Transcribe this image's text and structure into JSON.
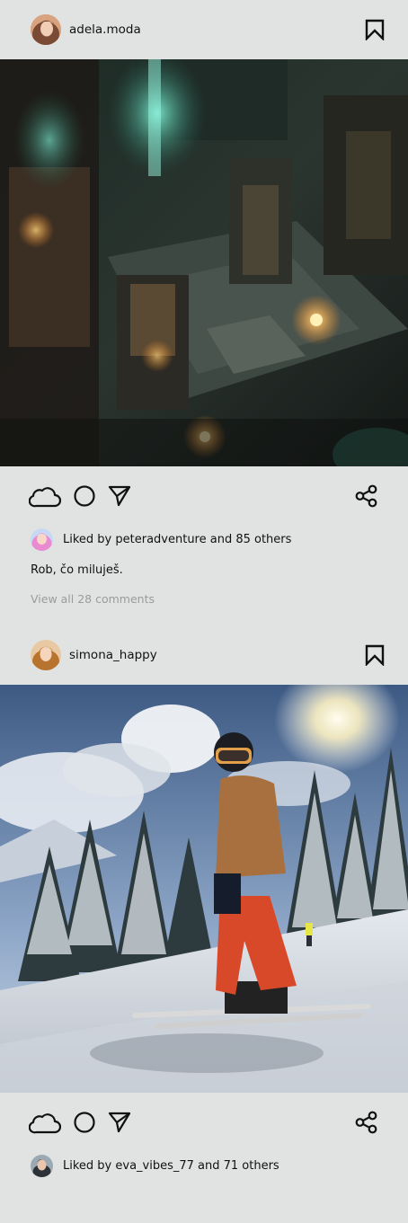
{
  "posts": [
    {
      "username": "adela.moda",
      "avatar_icon": "avatar-woman-icon",
      "photo_subject": "dark fantasy dungeon with green glowing portal and torches",
      "likes_text": "Liked by peteradventure and 85 others",
      "caption": "Rob, čo miluješ.",
      "comments_link": "View all 28 comments"
    },
    {
      "username": "simona_happy",
      "avatar_icon": "avatar-woman-icon",
      "photo_subject": "skier on snowy slope with pine trees and sun",
      "likes_text": "Liked by eva_vibes_77 and 71 others"
    }
  ],
  "icons": {
    "like": "cloud-icon",
    "comment": "circle-icon",
    "send": "send-triangle-icon",
    "share": "share-icon",
    "save": "bookmark-icon"
  },
  "colors": {
    "background": "#e1e3e2",
    "text": "#111111",
    "muted": "#9a9c9c"
  }
}
